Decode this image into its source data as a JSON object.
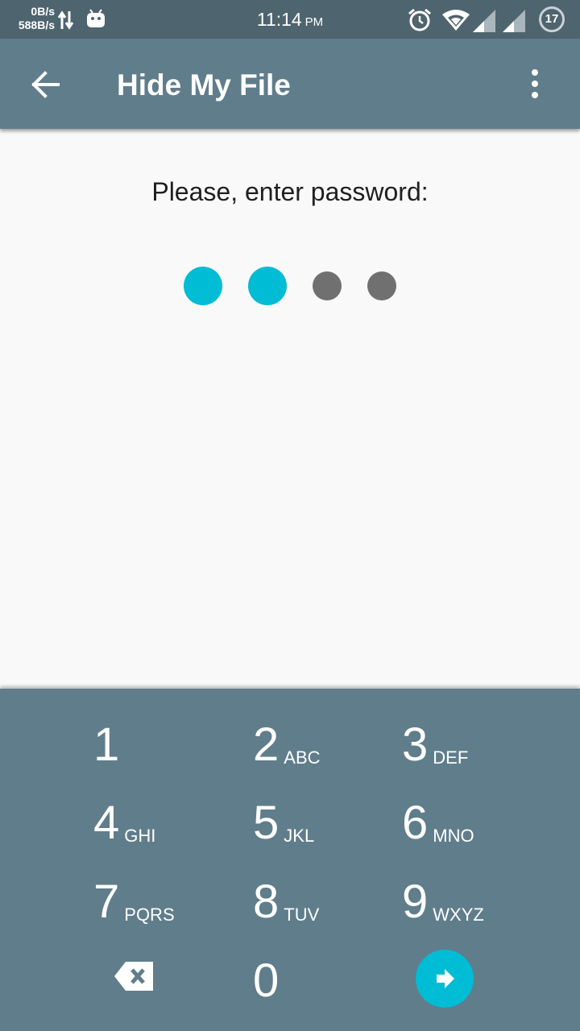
{
  "status_bar": {
    "net_up": "0B/s",
    "net_down": "588B/s",
    "time": "11:14",
    "ampm": "PM",
    "battery": "17"
  },
  "app_bar": {
    "title": "Hide My File",
    "back_icon": "arrow-back-icon",
    "menu_icon": "more-vert-icon"
  },
  "prompt": "Please, enter password:",
  "pin": {
    "length": 4,
    "entered": 2,
    "filled_color": "#00bcd4",
    "empty_color": "#707070"
  },
  "keypad": {
    "background": "#607d8b",
    "keys": [
      {
        "num": "1",
        "letters": ""
      },
      {
        "num": "2",
        "letters": "ABC"
      },
      {
        "num": "3",
        "letters": "DEF"
      },
      {
        "num": "4",
        "letters": "GHI"
      },
      {
        "num": "5",
        "letters": "JKL"
      },
      {
        "num": "6",
        "letters": "MNO"
      },
      {
        "num": "7",
        "letters": "PQRS"
      },
      {
        "num": "8",
        "letters": "TUV"
      },
      {
        "num": "9",
        "letters": "WXYZ"
      },
      {
        "num": "0",
        "letters": ""
      }
    ],
    "delete_icon": "backspace-icon",
    "enter_icon": "arrow-forward-icon",
    "enter_color": "#00bcd4"
  }
}
